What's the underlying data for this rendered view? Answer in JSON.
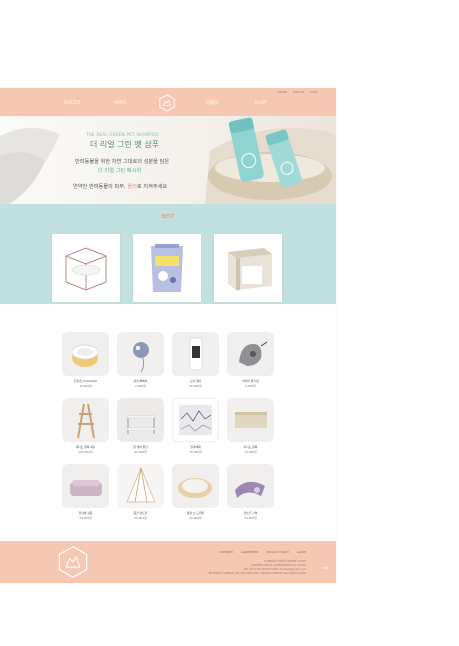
{
  "header": {
    "top_links": [
      "LOGIN",
      "JOIN US",
      "CART"
    ],
    "nav": [
      "자세그리",
      "브랜드",
      "다풀장",
      "고시판"
    ]
  },
  "hero": {
    "eyebrow": "THE REAL GREEN PET SHAMPOO",
    "title": "더 리얼 그린 펫 샴푸",
    "line1": "반려동물을 위한 자연 그대로의 성분을 담은",
    "line2": "더 리얼 그린 페시위",
    "line3_pre": "연약한 반려동물의 피부,",
    "line3_em": "플러",
    "line3_post": "로 지켜주세요"
  },
  "best": {
    "title": "BEST"
  },
  "products": [
    {
      "name": "친환경_Circlefeed",
      "price": "15,000원"
    },
    {
      "name": "쥐쥐 뻐빡이",
      "price": "6,000원"
    },
    {
      "name": "고야 워터",
      "price": "95,000원"
    },
    {
      "name": "허필터 방긴형",
      "price": "9,000원"
    },
    {
      "name": "레더트 원목 계단",
      "price": "105,000원"
    },
    {
      "name": "원 케파 원단",
      "price": "95,000원"
    },
    {
      "name": "물과해목",
      "price": "35,000원"
    },
    {
      "name": "아기도 원목",
      "price": "15,000원"
    },
    {
      "name": "플러와 장용",
      "price": "95,000원"
    },
    {
      "name": "중견 텐트인",
      "price": "55,000원"
    },
    {
      "name": "복을 스 도원원",
      "price": "45,000원"
    },
    {
      "name": "플쓰주 간이",
      "price": "35,000원"
    }
  ],
  "footer": {
    "links": [
      "COMPANY",
      "AGREEMENT",
      "PRIVACY POLICY",
      "GUIDE"
    ],
    "info": [
      "COMPANY FURLE  OWNER SUHYE",
      "ADDRESS SEOUL GUEMCHEON-GU 123-45",
      "TEL 010-1234-5678  E-MAIL furlepet@gmail.com",
      "BUSINESS LICENSE 123-45-67890  MAIL ORDER LICENSE 2024-SEOUL-0000"
    ],
    "top": "TOP"
  },
  "colors": {
    "peach": "#f6c8b4",
    "mint": "#c3e0e0",
    "teal_text": "#4e8e8c",
    "best_text": "#e58a73"
  }
}
